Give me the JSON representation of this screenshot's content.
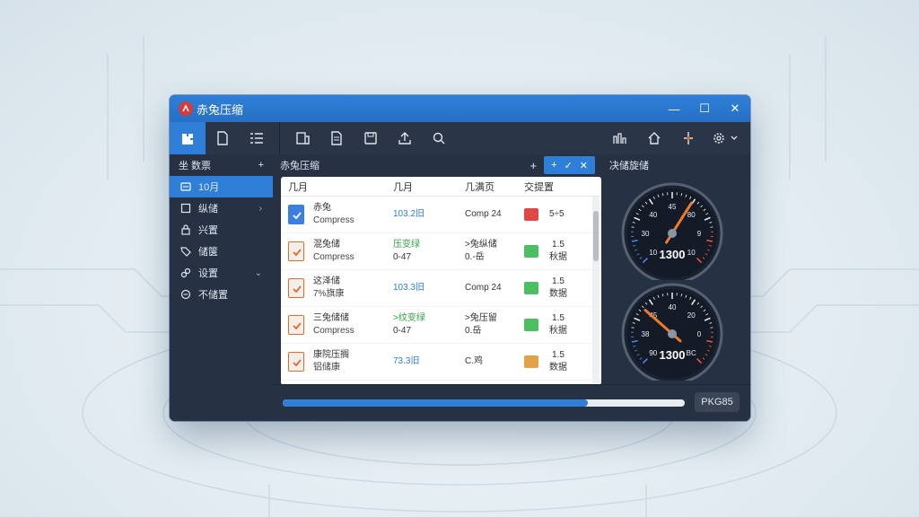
{
  "app": {
    "title": "赤兔压缩"
  },
  "window_controls": {
    "minimize": "—",
    "maximize": "☐",
    "close": "✕"
  },
  "sidebar": {
    "header": "坐 数票",
    "header_action": "+",
    "items": [
      {
        "label": "10月",
        "icon": "folder-icon",
        "selected": true
      },
      {
        "label": "纵储",
        "icon": "box-icon",
        "arrow": "›"
      },
      {
        "label": "兴置",
        "icon": "lock-icon"
      },
      {
        "label": "储箧",
        "icon": "tag-icon"
      },
      {
        "label": "设置",
        "icon": "link-icon",
        "arrow": "⌄"
      },
      {
        "label": "不储置",
        "icon": "minus-circle-icon"
      }
    ]
  },
  "main": {
    "header": "赤兔压缩",
    "header_add": "+",
    "header_actions": [
      "+",
      "✓",
      "✕"
    ],
    "columns": [
      "几月",
      "几月",
      "几满页",
      "交提置"
    ],
    "rows": [
      {
        "name": "赤兔",
        "sub": "Compress",
        "size": "103.2旧",
        "size2": "",
        "type": "Comp 24",
        "type2": "",
        "ratio": "5÷5",
        "ratio2": "",
        "icon_color": "#3b7fe0",
        "ratio_color": "#e04848"
      },
      {
        "name": "混兔储",
        "sub": "Compress",
        "size": "压变绿",
        "size2": "0-47",
        "type": ">兔纵储",
        "type2": "0.-岳",
        "ratio": "1.5",
        "ratio2": "秋据",
        "icon_color": "#e36b2d",
        "ratio_color": "#4cbf62"
      },
      {
        "name": "这泽储",
        "sub": "7%旗康",
        "size": "103.3旧",
        "size2": "",
        "type": "Comp 24",
        "type2": "",
        "ratio": "1.5",
        "ratio2": "数据",
        "icon_color": "#e36b2d",
        "ratio_color": "#4cbf62"
      },
      {
        "name": "三兔储储",
        "sub": "Compress",
        "size": ">纹变绿",
        "size2": "0-47",
        "type": ">兔压留",
        "type2": "0.岳",
        "ratio": "1.5",
        "ratio2": "秋据",
        "icon_color": "#e36b2d",
        "ratio_color": "#4cbf62"
      },
      {
        "name": "康院压搁",
        "sub": "铝储康",
        "size": "73.3旧",
        "size2": "",
        "type": "C.鸡",
        "type2": "",
        "ratio": "1.5",
        "ratio2": "数据",
        "icon_color": "#e36b2d",
        "ratio_color": "#e0a34a"
      }
    ]
  },
  "right": {
    "header": "决储旋储",
    "gauges": [
      {
        "value": "1300",
        "ticks": [
          "10",
          "30",
          "40",
          "45",
          "80",
          "9",
          "10"
        ],
        "needle": 0.62
      },
      {
        "value": "1300",
        "ticks": [
          "90",
          "38",
          "45",
          "40",
          "20",
          "0",
          "BC"
        ],
        "needle": 0.32
      }
    ]
  },
  "progress": {
    "value": 0.76,
    "badge": "PKG85"
  },
  "colors": {
    "accent": "#2f7fd8",
    "dark": "#263244",
    "title": "#2670c6"
  }
}
